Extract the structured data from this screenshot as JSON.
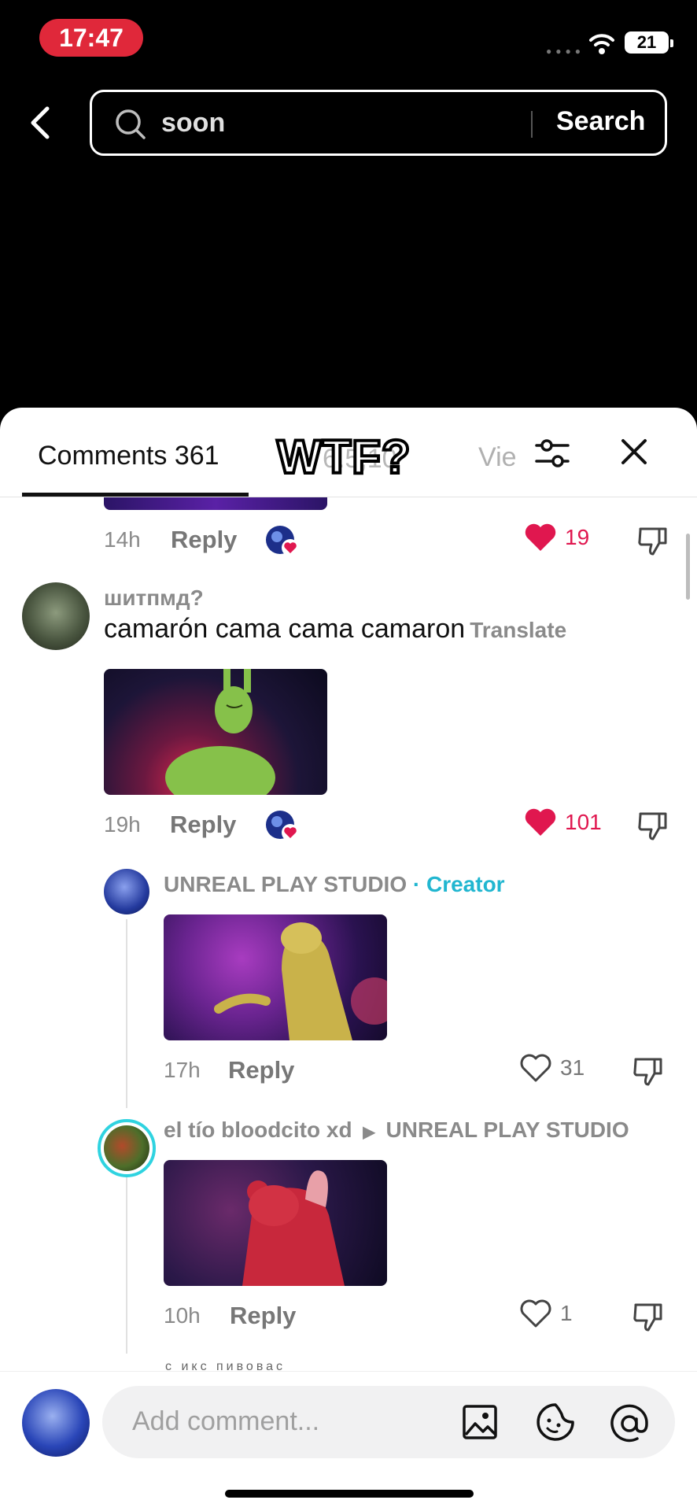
{
  "status_bar": {
    "time": "17:47",
    "battery": "21"
  },
  "search": {
    "value": "soon",
    "button_label": "Search"
  },
  "sheet": {
    "tab_comments": "Comments 361",
    "ghost_count": "6.5,10",
    "overlay_text": "WTF?",
    "tab_views": "Vie"
  },
  "comments": {
    "top": {
      "time": "14h",
      "reply": "Reply",
      "likes": "19"
    },
    "main": {
      "author": "шитпмд?",
      "text": "camarón cama cama camaron",
      "translate": "Translate",
      "time": "19h",
      "reply": "Reply",
      "likes": "101"
    },
    "reply1": {
      "author": "UNREAL PLAY STUDIO",
      "badge_sep": "·",
      "badge": "Creator",
      "time": "17h",
      "reply": "Reply",
      "likes": "31"
    },
    "reply2": {
      "author": "el tío bloodcito xd",
      "target": "UNREAL PLAY STUDIO",
      "time": "10h",
      "reply": "Reply",
      "likes": "1"
    },
    "peek_text": "с икс пивовас"
  },
  "composer": {
    "placeholder": "Add comment..."
  },
  "colors": {
    "like_red": "#e0174f",
    "creator_cyan": "#21b6d0",
    "time_pill": "#e0283a"
  }
}
